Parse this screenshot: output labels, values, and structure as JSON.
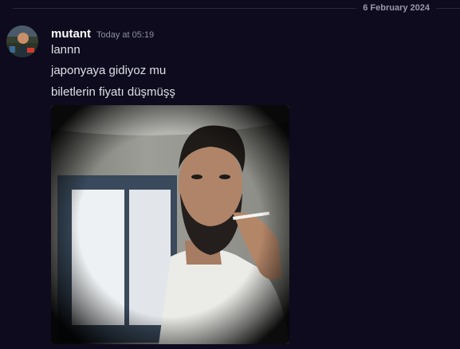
{
  "date_divider": "6 February 2024",
  "message": {
    "author": "mutant",
    "timestamp": "Today at 05:19",
    "lines": [
      "lannn",
      "japonyaya gidiyoz mu",
      "biletlerin fiyatı düşmüşş"
    ]
  },
  "attachment": {
    "type": "video",
    "subject": "bearded man smoking a cigarette in white t-shirt",
    "icon": "video-thumbnail"
  },
  "colors": {
    "background": "#0d0b1d",
    "username": "#ffffff",
    "text": "#dfe0e6",
    "muted": "#8f8ea3"
  }
}
